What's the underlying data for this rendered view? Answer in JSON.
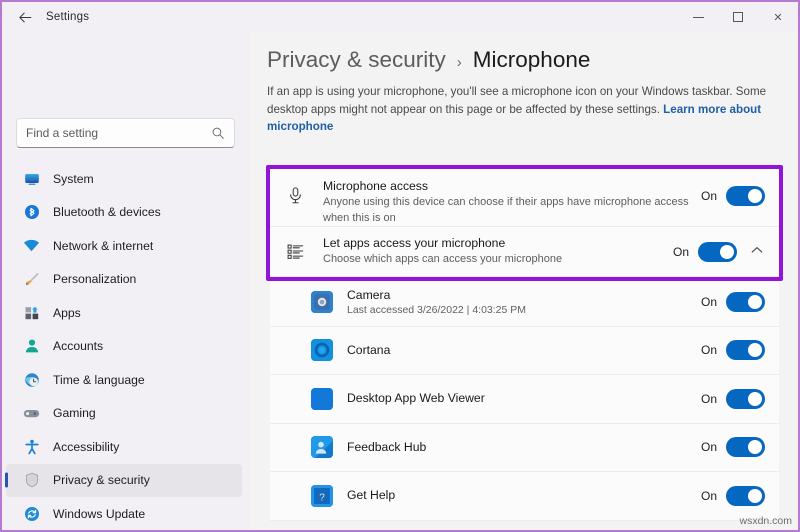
{
  "window": {
    "title": "Settings",
    "back_icon": "back-arrow-icon",
    "minimize_label": "",
    "maximize_label": "",
    "close_label": "✕"
  },
  "search": {
    "placeholder": "Find a setting",
    "value": "",
    "icon": "search-icon"
  },
  "sidebar": {
    "items": [
      {
        "label": "System",
        "icon": "monitor-icon",
        "active": false
      },
      {
        "label": "Bluetooth & devices",
        "icon": "bluetooth-icon",
        "active": false
      },
      {
        "label": "Network & internet",
        "icon": "wifi-icon",
        "active": false
      },
      {
        "label": "Personalization",
        "icon": "paintbrush-icon",
        "active": false
      },
      {
        "label": "Apps",
        "icon": "apps-grid-icon",
        "active": false
      },
      {
        "label": "Accounts",
        "icon": "person-icon",
        "active": false
      },
      {
        "label": "Time & language",
        "icon": "clock-globe-icon",
        "active": false
      },
      {
        "label": "Gaming",
        "icon": "gamepad-icon",
        "active": false
      },
      {
        "label": "Accessibility",
        "icon": "accessibility-icon",
        "active": false
      },
      {
        "label": "Privacy & security",
        "icon": "shield-icon",
        "active": true
      },
      {
        "label": "Windows Update",
        "icon": "update-sync-icon",
        "active": false
      }
    ]
  },
  "header": {
    "breadcrumb_parent": "Privacy & security",
    "breadcrumb_separator": "›",
    "breadcrumb_current": "Microphone",
    "description_text": "If an app is using your microphone, you'll see a microphone icon on your Windows taskbar. Some desktop apps might not appear on this page or be affected by these settings. ",
    "learn_more_link": "Learn more about microphone"
  },
  "settings": {
    "microphone_access": {
      "title": "Microphone access",
      "subtitle": "Anyone using this device can choose if their apps have microphone access when this is on",
      "state": "On",
      "icon": "microphone-icon"
    },
    "let_apps_access": {
      "title": "Let apps access your microphone",
      "subtitle": "Choose which apps can access your microphone",
      "state": "On",
      "icon": "app-list-icon",
      "expander_icon": "chevron-up-icon"
    }
  },
  "apps": [
    {
      "name": "Camera",
      "sub": "Last accessed 3/26/2022  |  4:03:25 PM",
      "state": "On",
      "icon": "camera-app-icon",
      "color": "#1b7fd6"
    },
    {
      "name": "Cortana",
      "sub": "",
      "state": "On",
      "icon": "cortana-app-icon",
      "color": "#1490e0"
    },
    {
      "name": "Desktop App Web Viewer",
      "sub": "",
      "state": "On",
      "icon": "webviewer-app-icon",
      "color": "#1478d8"
    },
    {
      "name": "Feedback Hub",
      "sub": "",
      "state": "On",
      "icon": "feedback-app-icon",
      "color": "#1b9ae8"
    },
    {
      "name": "Get Help",
      "sub": "",
      "state": "On",
      "icon": "gethelp-app-icon",
      "color": "#1478c8"
    }
  ],
  "annotation": {
    "highlight_color": "#9214d6"
  },
  "watermark": "wsxdn.com"
}
